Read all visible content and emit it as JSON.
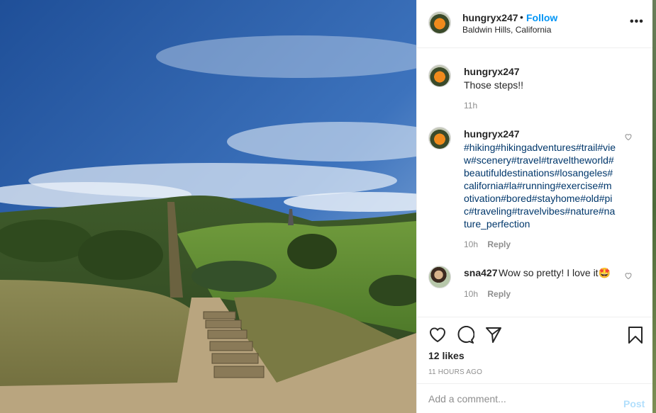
{
  "post": {
    "username": "hungryx247",
    "follow_label": "Follow",
    "separator": "•",
    "location": "Baldwin Hills, California",
    "more_label": "•••",
    "image_icon": "landscape-photo"
  },
  "comments": [
    {
      "username": "hungryx247",
      "text": "Those steps!!",
      "time": "11h"
    },
    {
      "username": "hungryx247",
      "text": "#hiking#hikingadventures#trail#view#scenery#travel#traveltheworld#beautifuldestinations#losangeles#california#la#running#exercise#motivation#bored#stayhome#old#pic#traveling#travelvibes#nature#nature_perfection",
      "time": "10h",
      "reply_label": "Reply"
    },
    {
      "username": "sna427",
      "text": "Wow so pretty! I love it🤩",
      "time": "10h",
      "reply_label": "Reply"
    }
  ],
  "actions": {
    "like_icon": "heart-icon",
    "comment_icon": "comment-icon",
    "share_icon": "share-icon",
    "save_icon": "bookmark-icon"
  },
  "likes": "12 likes",
  "timestamp": "11 HOURS AGO",
  "add_comment": {
    "placeholder": "Add a comment...",
    "post_label": "Post"
  },
  "colors": {
    "link_blue": "#0095f6",
    "hashtag": "#00376b",
    "muted": "#8e8e8e",
    "post_disabled": "#b2dffc"
  }
}
